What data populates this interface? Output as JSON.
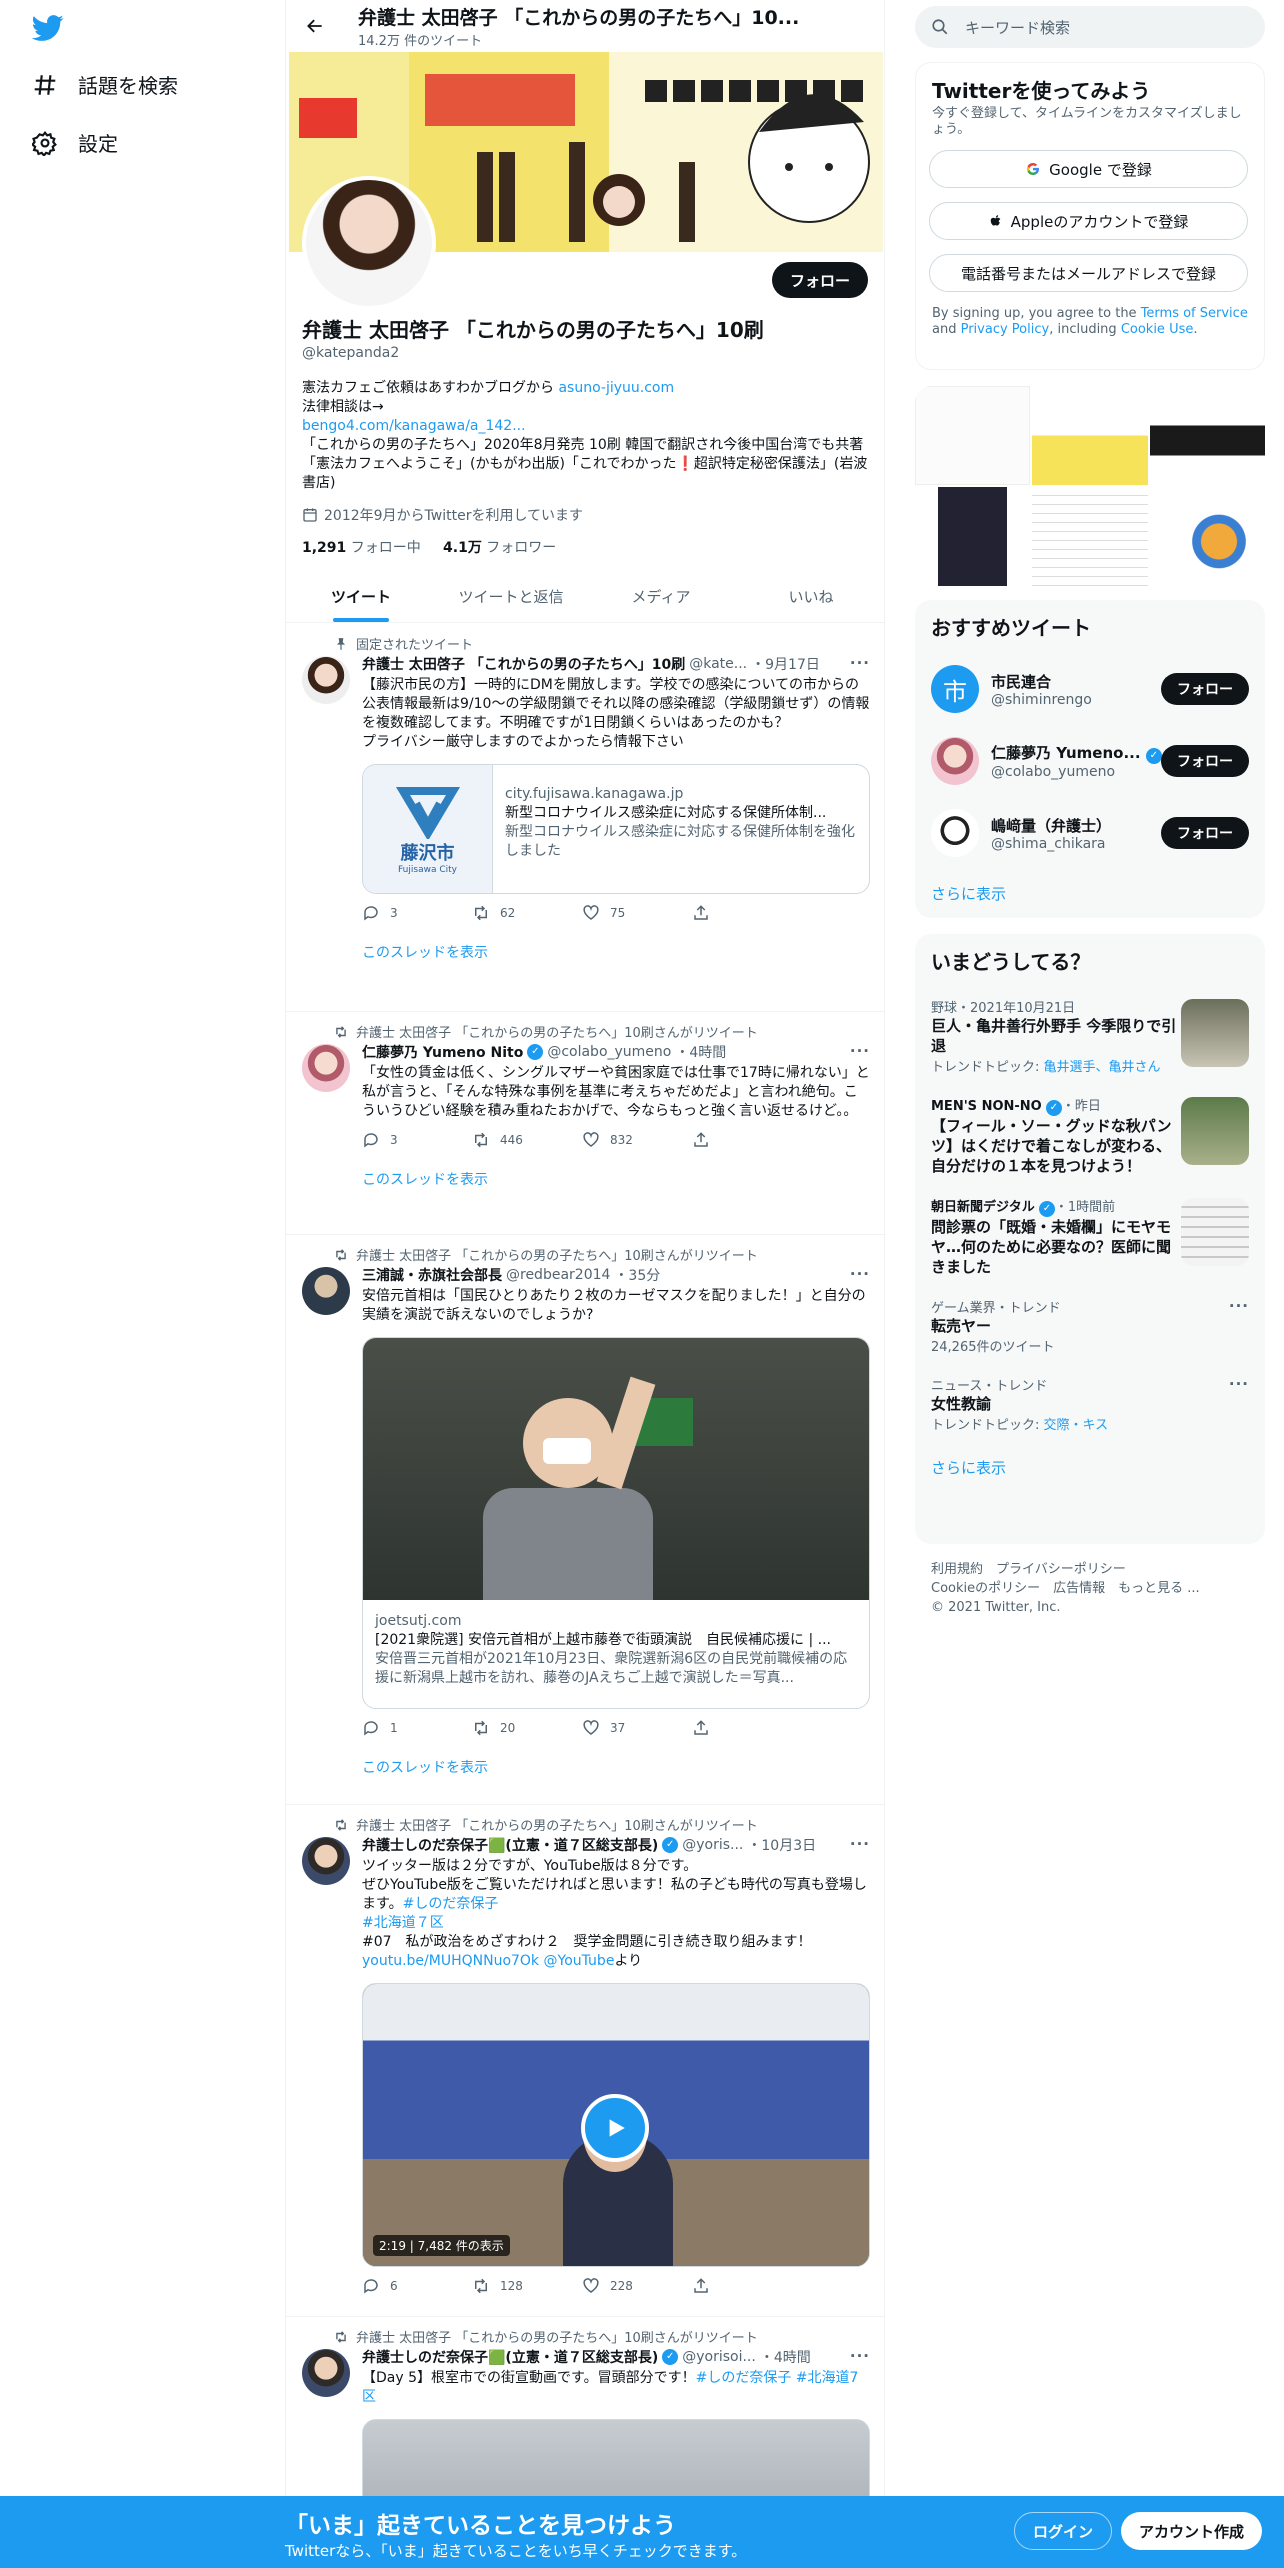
{
  "colors": {
    "accent": "#1d9bf0",
    "dark": "#0f1419",
    "muted": "#536471"
  },
  "nav": {
    "items": [
      {
        "label": "話題を検索",
        "icon": "hashtag-icon"
      },
      {
        "label": "設定",
        "icon": "gear-icon"
      }
    ]
  },
  "header": {
    "title": "弁護士 太田啓子 「これからの男の子たちへ」10...",
    "tweet_count": "14.2万 件のツイート"
  },
  "profile": {
    "follow_label": "フォロー",
    "name": "弁護士 太田啓子 「これからの男の子たちへ」10刷",
    "handle": "@katepanda2",
    "bio_line1": "憲法カフェご依頼はあすわかブログから ",
    "bio_link1": "asuno-jiyuu.com",
    "bio_line2": "法律相談は→",
    "bio_link2": "bengo4.com/kanagawa/a_142...",
    "bio_line3": "「これからの男の子たちへ」2020年8月発売 10刷 韓国で翻訳され今後中国台湾でも共著「憲法カフェへようこそ」(かもがわ出版)「これでわかった❗️超訳特定秘密保護法」(岩波書店)",
    "joined": "2012年9月からTwitterを利用しています",
    "following_count": "1,291",
    "following_label": " フォロー中",
    "followers_count": "4.1万",
    "followers_label": " フォロワー"
  },
  "tabs": [
    "ツイート",
    "ツイートと返信",
    "メディア",
    "いいね"
  ],
  "tweets": [
    {
      "context": "固定されたツイート",
      "name": "弁護士 太田啓子 「これからの男の子たちへ」10刷",
      "handle": "@kate...",
      "time": "・9月17日",
      "text": "【藤沢市民の方】一時的にDMを開放します。学校での感染についての市からの公表情報最新は9/10～の学級閉鎖でそれ以降の感染確認（学級閉鎖せず）の情報を複数確認してます。不明確ですが1日閉鎖くらいはあったのかも？\nプライバシー厳守しますのでよかったら情報下さい",
      "card": {
        "domain": "city.fujisawa.kanagawa.jp",
        "title": "新型コロナウイルス感染症に対応する保健所体制...",
        "desc": "新型コロナウイルス感染症に対応する保健所体制を強化しました",
        "logo_text": "藤沢市",
        "logo_sub": "Fujisawa City"
      },
      "replies": "3",
      "retweets": "62",
      "likes": "75",
      "thread": "このスレッドを表示"
    },
    {
      "context": "弁護士 太田啓子 「これからの男の子たちへ」10刷さんがリツイート",
      "name": "仁藤夢乃 Yumeno Nito",
      "handle": "@colabo_yumeno",
      "time": "・4時間",
      "text": "「女性の賃金は低く、シングルマザーや貧困家庭では仕事で17時に帰れない」と私が言うと、「そんな特殊な事例を基準に考えちゃだめだよ」と言われ絶句。こういうひどい経験を積み重ねたおかげで、今ならもっと強く言い返せるけど。。",
      "replies": "3",
      "retweets": "446",
      "likes": "832",
      "thread": "このスレッドを表示"
    },
    {
      "context": "弁護士 太田啓子 「これからの男の子たちへ」10刷さんがリツイート",
      "name": "三浦誠・赤旗社会部長",
      "handle": "@redbear2014",
      "time": "・35分",
      "text": "安倍元首相は「国民ひとりあたり２枚のカーゼマスクを配りました！」と自分の実績を演説で訴えないのでしょうか?",
      "card": {
        "domain": "joetsutj.com",
        "title": "[2021衆院選] 安倍元首相が上越市藤巻で街頭演説　自民候補応援に | ...",
        "desc": "安倍晋三元首相が2021年10月23日、衆院選新潟6区の自民党前職候補の応援に新潟県上越市を訪れ、藤巻のJAえちご上越で演説した＝写真..."
      },
      "replies": "1",
      "retweets": "20",
      "likes": "37",
      "thread": "このスレッドを表示"
    },
    {
      "context": "弁護士 太田啓子 「これからの男の子たちへ」10刷さんがリツイート",
      "name": "弁護士しのだ奈保子🟩(立憲・道７区総支部長)",
      "handle": "@yoris...",
      "time": "・10月3日",
      "text1": "ツイッター版は２分ですが、YouTube版は８分です。\nぜひYouTube版をご覧いただければと思います！私の子ども時代の写真も登場します。",
      "hashtag1": "#しのだ奈保子",
      "hashtag2": "#北海道７区",
      "text2": "#07　私が政治をめざすわけ２　奨学金問題に引き続き取り組みます！",
      "link": "youtu.be/MUHQNNuo7Ok",
      "mention": "@YouTube",
      "mention_suffix": "より",
      "video_badge": "2:19 | 7,482 件の表示",
      "replies": "6",
      "retweets": "128",
      "likes": "228"
    },
    {
      "context": "弁護士 太田啓子 「これからの男の子たちへ」10刷さんがリツイート",
      "name": "弁護士しのだ奈保子🟩(立憲・道７区総支部長)",
      "handle": "@yorisoi...",
      "time": "・4時間",
      "text": "【Day 5】根室市での街宣動画です。冒頭部分です！",
      "hashtags": "#しのだ奈保子 #北海道7区"
    }
  ],
  "right": {
    "search_placeholder": "キーワード検索",
    "signup": {
      "title": "Twitterを使ってみよう",
      "subtitle": "今すぐ登録して、タイムラインをカスタマイズしましょう。",
      "google": "Google で登録",
      "apple": "Appleのアカウントで登録",
      "phone": "電話番号またはメールアドレスで登録",
      "terms_pre": "By signing up, you agree to the ",
      "terms": "Terms of Service",
      "terms_and": " and ",
      "privacy": "Privacy Policy",
      "terms_mid": ", including ",
      "cookie": "Cookie Use",
      "terms_end": "."
    },
    "wtf": {
      "title": "おすすめツイート",
      "users": [
        {
          "name": "市民連合",
          "handle": "@shiminrengo",
          "button": "フォロー"
        },
        {
          "name": "仁藤夢乃 Yumeno...",
          "handle": "@colabo_yumeno",
          "button": "フォロー"
        },
        {
          "name": "嶋﨑量（弁護士）",
          "handle": "@shima_chikara",
          "button": "フォロー"
        }
      ],
      "more": "さらに表示"
    },
    "trends": {
      "title": "いまどうしてる？",
      "items": [
        {
          "meta": "野球・2021年10月21日",
          "title": "巨人・亀井善行外野手 今季限りで引退",
          "sub_pre": "トレンドトピック: ",
          "sub_links": "亀井選手、亀井さん"
        },
        {
          "meta": "MEN'S NON-NO",
          "meta_time": "・昨日",
          "title": "【フィール・ソー・グッドな秋パンツ】はくだけで着こなしが変わる、自分だけの１本を見つけよう！"
        },
        {
          "meta": "朝日新聞デジタル",
          "meta_time": "・1時間前",
          "title": "問診票の「既婚・未婚欄」にモヤモヤ…何のために必要なの？医師に聞きました"
        },
        {
          "meta": "ゲーム業界・トレンド",
          "title": "転売ヤー",
          "sub": "24,265件のツイート"
        },
        {
          "meta": "ニュース・トレンド",
          "title": "女性教諭",
          "sub_pre": "トレンドトピック: ",
          "sub_links": "交際・キス"
        }
      ],
      "more": "さらに表示"
    },
    "footer": {
      "line1": "利用規約　プライバシーポリシー",
      "line2": "Cookieのポリシー　広告情報　もっと見る ...",
      "line3": "© 2021 Twitter, Inc."
    }
  },
  "bottom": {
    "title": "「いま」起きていることを見つけよう",
    "subtitle": "Twitterなら、「いま」起きていることをいち早くチェックできます。",
    "login": "ログイン",
    "signup": "アカウント作成"
  }
}
